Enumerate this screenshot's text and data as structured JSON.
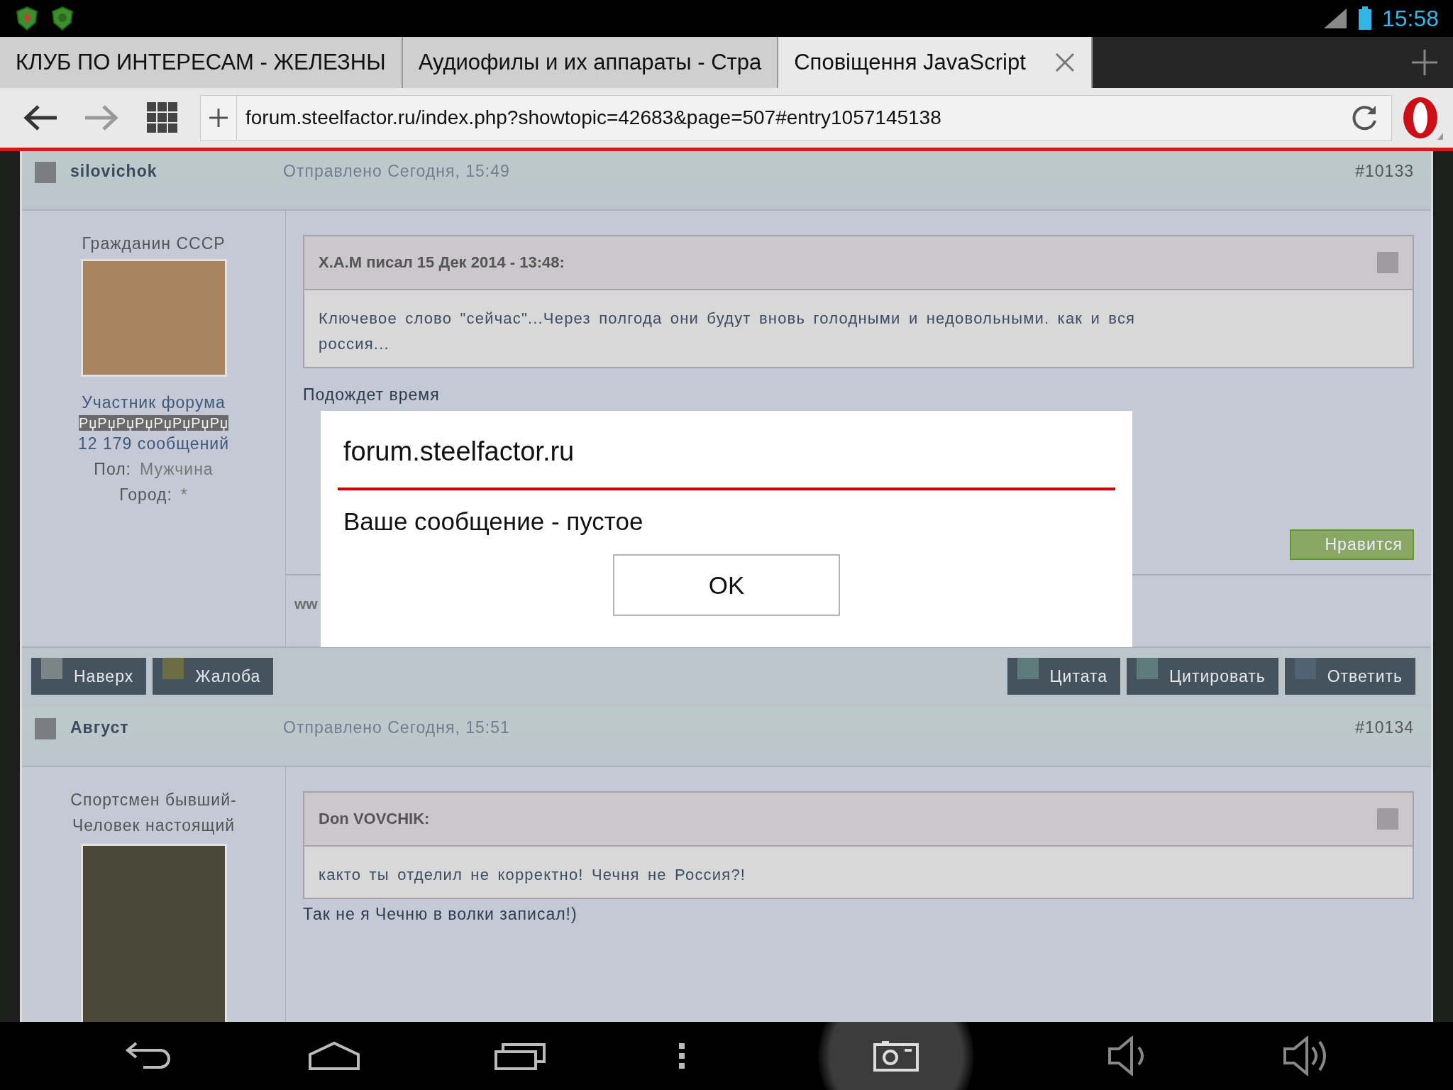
{
  "status_bar": {
    "time": "15:58"
  },
  "tabs": [
    {
      "title": "КЛУБ ПО ИНТЕРЕСАМ - ЖЕЛЕЗНЫ",
      "selected": false
    },
    {
      "title": "Аудиофилы и их аппараты - Стра",
      "selected": false
    },
    {
      "title": "Сповіщення JavaScript",
      "selected": true
    }
  ],
  "address_bar": {
    "url": "forum.steelfactor.ru/index.php?showtopic=42683&page=507#entry1057145138"
  },
  "posts": [
    {
      "author": "silovichok",
      "posted": "Отправлено Сегодня, 15:49",
      "number": "#10133",
      "user_title": "Гражданин СССР",
      "avatar": {
        "color": "#a8845f"
      },
      "group": "Участник форума",
      "garbled": "РџРџРџРџРџРџРџРџ",
      "post_count": "12 179 сообщений",
      "fields": [
        {
          "label": "Пол:",
          "value": "Мужчина"
        },
        {
          "label": "Город:",
          "value": "*"
        }
      ],
      "quote": {
        "header": "Х.А.М писал 15 Дек 2014 - 13:48:",
        "text": "Ключевое слово \"сейчас\"...Через  полгода они будут вновь голодными и недовольными.  как и вся россия..."
      },
      "text": "Подождет время",
      "like_button": "Нравится",
      "signature": "ww",
      "buttons_left": [
        {
          "label": "Наверх",
          "color": "#7b8585"
        },
        {
          "label": "Жалоба",
          "color": "#6d6d43"
        }
      ],
      "buttons_right": [
        {
          "label": "Цитата",
          "color": "#5e7a7a"
        },
        {
          "label": "Цитировать",
          "color": "#5e7a7a"
        },
        {
          "label": "Ответить",
          "color": "#506274"
        }
      ]
    },
    {
      "author": "Август",
      "posted": "Отправлено Сегодня, 15:51",
      "number": "#10134",
      "user_title": "Спортсмен бывший-Человек настоящий",
      "avatar": {
        "color": "#4a4839"
      },
      "quote": {
        "header": "Don VOVCHIK:",
        "text": "както ты отделил не корректно! Чечня не Россия?!"
      },
      "text": "Так не я Чечню в волки записал!)"
    }
  ],
  "dialog": {
    "title": "forum.steelfactor.ru",
    "message": "Ваше сообщение - пустое",
    "button": "OK"
  }
}
